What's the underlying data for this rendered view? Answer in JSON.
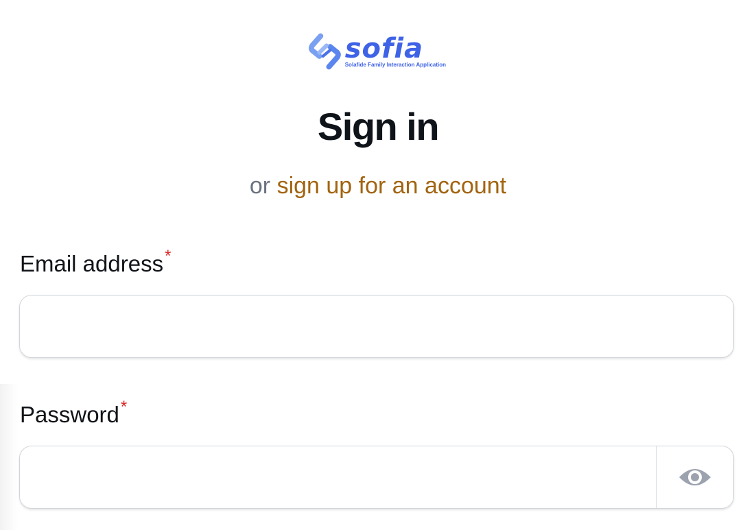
{
  "logo": {
    "word": "sofia",
    "tagline": "Solafide Family Interaction Application"
  },
  "heading": {
    "title": "Sign in",
    "subtitle_prefix": "or",
    "signup_link": "sign up for an account"
  },
  "form": {
    "email": {
      "label": "Email address",
      "required_mark": "*",
      "value": ""
    },
    "password": {
      "label": "Password",
      "required_mark": "*",
      "value": ""
    },
    "toggle_icon": "eye-icon"
  },
  "colors": {
    "brand": "#3f63e6",
    "link": "#a26410",
    "required": "#dc2626"
  }
}
